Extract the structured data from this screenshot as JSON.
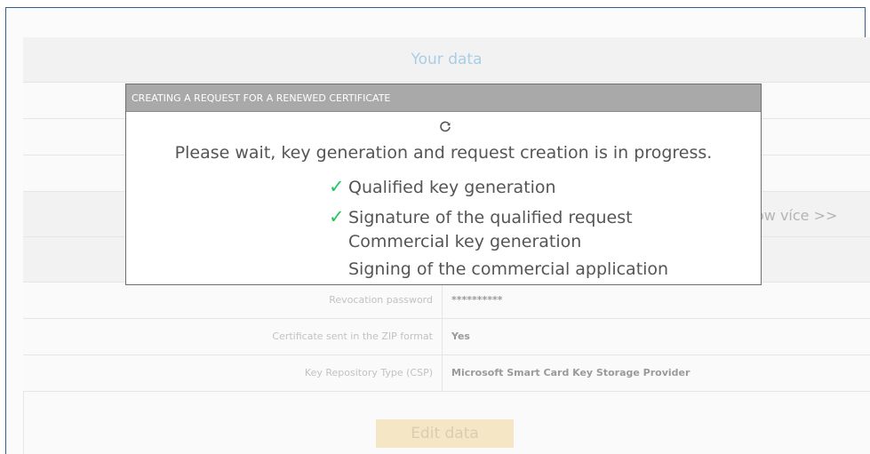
{
  "panel": {
    "title": "Your data",
    "show_more": "ow více >>",
    "rows": [
      {
        "label": "Revocation password",
        "value": "**********"
      },
      {
        "label": "Certificate sent in the ZIP format",
        "value": "Yes"
      },
      {
        "label": "Key Repository Type (CSP)",
        "value": "Microsoft Smart Card Key Storage Provider"
      }
    ],
    "edit_button": "Edit data"
  },
  "modal": {
    "title": "CREATING A REQUEST FOR A RENEWED CERTIFICATE",
    "spinner_icon": "spinner-icon",
    "message": "Please wait, key generation and request creation is in progress.",
    "steps": [
      {
        "label": "Qualified key generation",
        "done": true
      },
      {
        "label": "Signature of the qualified request",
        "done": true
      },
      {
        "label": "Commercial key generation",
        "done": false
      },
      {
        "label": "Signing of the commercial application",
        "done": false
      }
    ],
    "check_color": "#22c55e"
  }
}
